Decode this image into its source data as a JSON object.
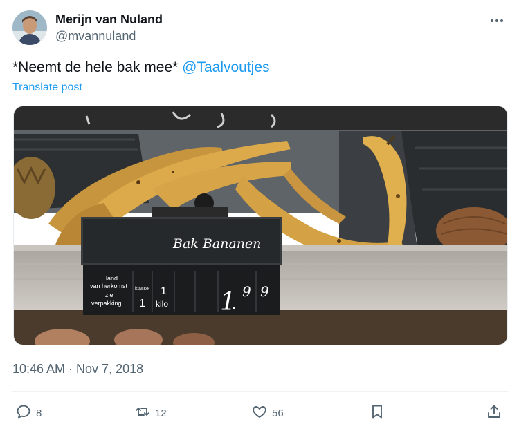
{
  "tweet": {
    "author": {
      "display_name": "Merijn van Nuland",
      "handle": "@mvannuland"
    },
    "text_plain": "*Neemt de hele bak mee* ",
    "mention": "@Taalvoutjes",
    "translate_label": "Translate post",
    "timestamp": "10:46 AM · Nov 7, 2018"
  },
  "photo_sign": {
    "title": "Bak Bananen",
    "origin_label": "land van herkomst",
    "origin_value": "zie verpakking",
    "class_label": "klasse",
    "class_value": "1",
    "unit_amount": "1",
    "unit": "kilo",
    "price_int": "1",
    "price_dec_1": "9",
    "price_dec_2": "9"
  },
  "actions": {
    "reply_count": "8",
    "retweet_count": "12",
    "like_count": "56"
  },
  "icons": [
    "more-icon",
    "reply-icon",
    "retweet-icon",
    "like-icon",
    "bookmark-icon",
    "share-icon"
  ],
  "colors": {
    "link": "#1d9bf0",
    "text": "#0f1419",
    "muted": "#536471"
  }
}
